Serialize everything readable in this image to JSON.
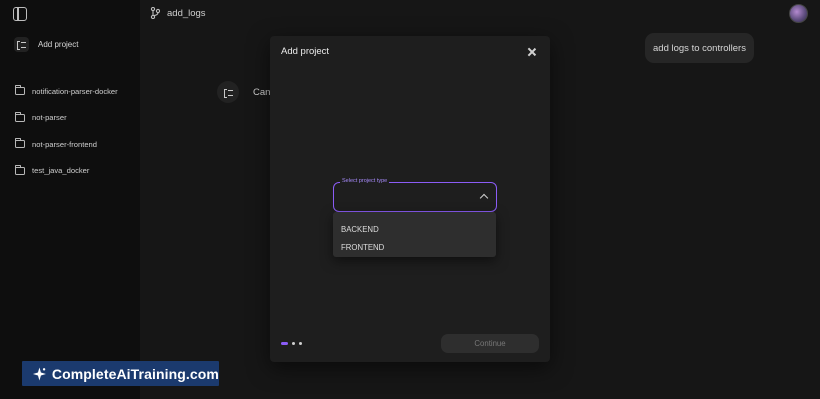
{
  "sidebar": {
    "add_project_label": "Add project",
    "projects": [
      {
        "label": "notification-parser-docker"
      },
      {
        "label": "not-parser"
      },
      {
        "label": "not-parser-frontend"
      },
      {
        "label": "test_java_docker"
      }
    ]
  },
  "topbar": {
    "branch_label": "add_logs"
  },
  "chat": {
    "user_message": "add logs to controllers",
    "assistant_message": "Canc"
  },
  "modal": {
    "title": "Add project",
    "select": {
      "label": "Select project type",
      "value": "",
      "options": [
        "BACKEND",
        "FRONTEND"
      ]
    },
    "steps": {
      "total": 3,
      "current": 1
    },
    "continue_label": "Continue"
  },
  "watermark": {
    "text": "CompleteAiTraining.com"
  },
  "colors": {
    "accent": "#8b5cf6",
    "background": "#161616",
    "sidebar": "#0e0e0e",
    "modal": "#1e1e1e",
    "watermark_bg": "#1b3a6e"
  }
}
